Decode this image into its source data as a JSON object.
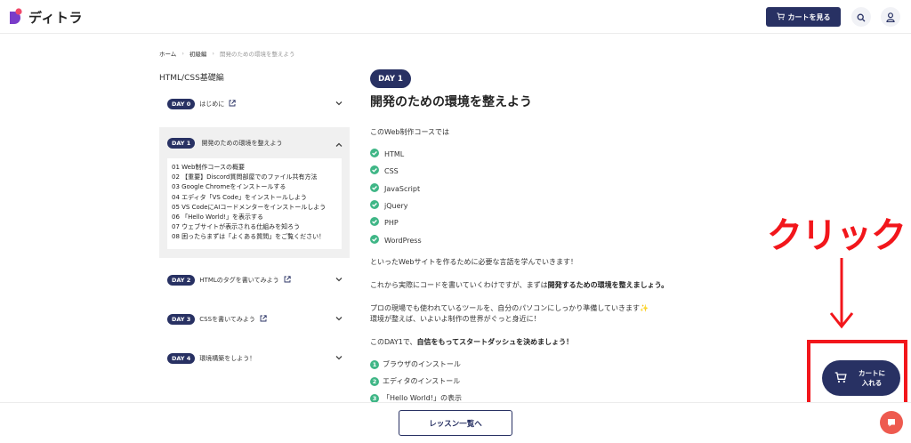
{
  "header": {
    "logo_text": "ディトラ",
    "cart_label": "カートを見る"
  },
  "breadcrumb": [
    "ホーム",
    "初級編",
    "開発のための環境を整えよう"
  ],
  "sidebar": {
    "title": "HTML/CSS基礎編",
    "items": [
      {
        "day": "DAY 0",
        "label": "はじめに"
      },
      {
        "day": "DAY 1",
        "label": "開発のための環境を整えよう"
      },
      {
        "day": "DAY 2",
        "label": "HTMLのタグを書いてみよう"
      },
      {
        "day": "DAY 3",
        "label": "CSSを書いてみよう"
      },
      {
        "day": "DAY 4",
        "label": "環境構築をしよう！"
      }
    ],
    "lessons": [
      "01 Web制作コースの概要",
      "02 【重要】Discord質問部屋でのファイル共有方法",
      "03 Google Chromeをインストールする",
      "04 エディタ「VS Code」をインストールしよう",
      "05 VS CodeにAIコードメンターをインストールしよう",
      "06 「Hello World!」を表示する",
      "07 ウェブサイトが表示される仕組みを知ろう",
      "08 困ったらまずは「よくある質問」をご覧ください！"
    ]
  },
  "main": {
    "day_badge": "DAY 1",
    "title": "開発のための環境を整えよう",
    "intro": "このWeb制作コースでは",
    "languages": [
      "HTML",
      "CSS",
      "JavaScript",
      "jQuery",
      "PHP",
      "WordPress"
    ],
    "p1": "といったWebサイトを作るために必要な言語を学んでいきます！",
    "p2_prefix": "これから実際にコードを書いていくわけですが、まずは",
    "p2_bold": "開発するための環境を整えましょう。",
    "p3_line1": "プロの現場でも使われているツールを、自分のパソコンにしっかり準備していきます✨",
    "p3_line2": "環境が整えば、いよいよ制作の世界がぐっと身近に！",
    "p4_prefix": "このDAY1で、",
    "p4_bold": "自信をもってスタートダッシュを決めましょう！",
    "steps": [
      {
        "num": "1",
        "label": "ブラウザのインストール"
      },
      {
        "num": "2",
        "label": "エディタのインストール"
      },
      {
        "num": "3",
        "label": "「Hello World!」の表示"
      }
    ]
  },
  "annotation": {
    "text": "クリック"
  },
  "add_to_cart": {
    "line1": "カートに",
    "line2": "入れる"
  },
  "footer": {
    "lesson_list_label": "レッスン一覧へ"
  },
  "colors": {
    "navy": "#283163",
    "green": "#3fb686",
    "red_annotation": "#f2161b",
    "chat": "#ee5a4f"
  }
}
